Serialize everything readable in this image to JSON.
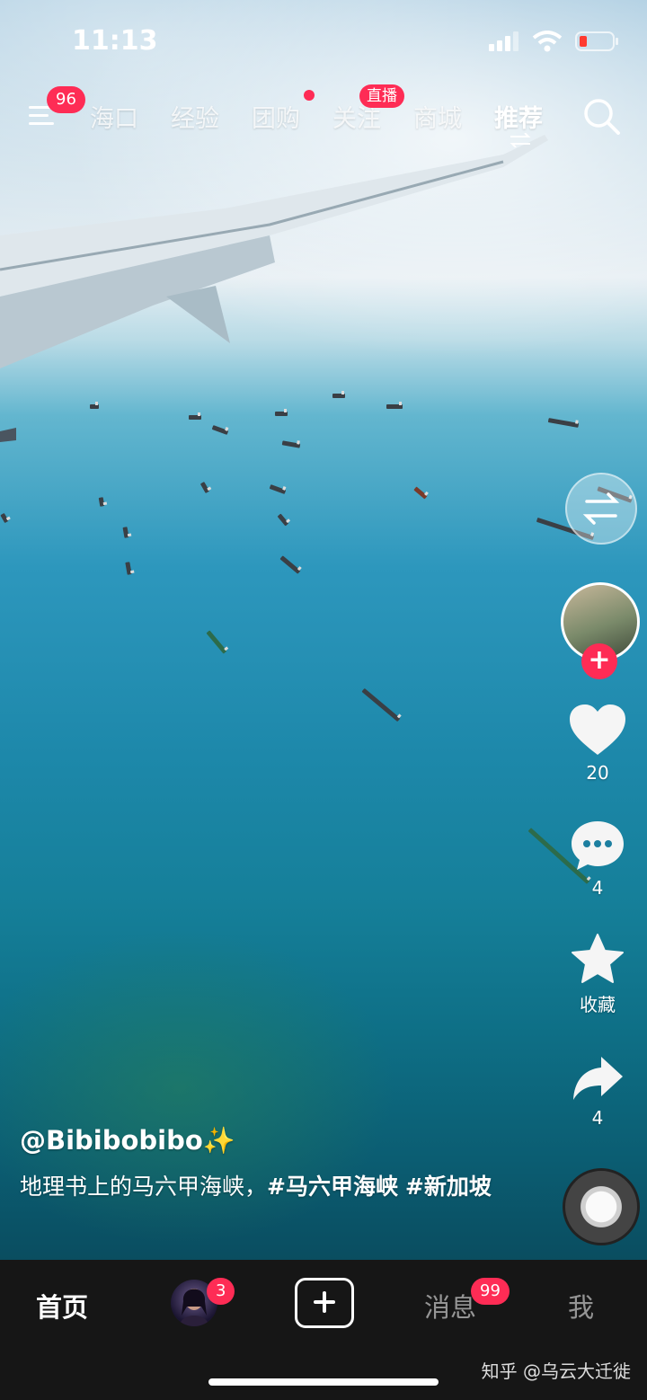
{
  "status_bar": {
    "time": "11:13",
    "battery_color": "#ff3b30"
  },
  "top_nav": {
    "menu_badge": "96",
    "tabs": [
      {
        "label": "海口"
      },
      {
        "label": "经验"
      },
      {
        "label": "团购"
      },
      {
        "label": "关注"
      },
      {
        "label": "商城"
      },
      {
        "label": "推荐"
      }
    ],
    "live_badge": "直播",
    "active_tab": "推荐"
  },
  "side_actions": {
    "like_count": "20",
    "comment_count": "4",
    "favorite_label": "收藏",
    "share_count": "4"
  },
  "video_info": {
    "author": "@Bibibobibo✨",
    "description_text": "地理书上的马六甲海峡，",
    "hashtags": [
      "#马六甲海峡",
      "#新加坡"
    ]
  },
  "bottom_nav": {
    "home_label": "首页",
    "friends_badge": "3",
    "messages_label": "消息",
    "messages_badge": "99",
    "me_label": "我"
  },
  "watermark": "知乎 @乌云大迁徙",
  "colors": {
    "accent": "#fe2c55",
    "bar_bg": "#161616"
  }
}
